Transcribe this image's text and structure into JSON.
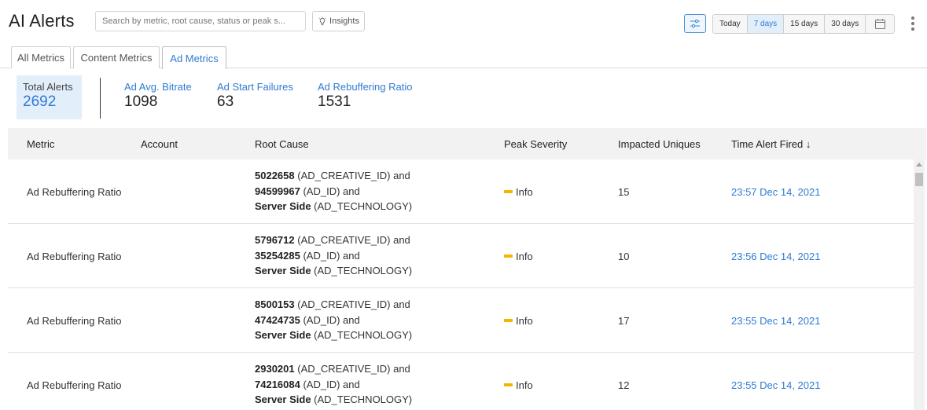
{
  "header": {
    "title": "AI Alerts",
    "search_placeholder": "Search by metric, root cause, status or peak s...",
    "insights_label": "Insights",
    "filter_icon": "sliders-icon",
    "ranges": [
      {
        "label": "Today",
        "active": false
      },
      {
        "label": "7 days",
        "active": true
      },
      {
        "label": "15 days",
        "active": false
      },
      {
        "label": "30 days",
        "active": false
      }
    ],
    "calendar_icon": "calendar-icon",
    "more_icon": "kebab-menu-icon"
  },
  "tabs": [
    {
      "label": "All Metrics",
      "active": false
    },
    {
      "label": "Content Metrics",
      "active": false
    },
    {
      "label": "Ad Metrics",
      "active": true
    }
  ],
  "stats": {
    "total": {
      "label": "Total Alerts",
      "value": "2692"
    },
    "items": [
      {
        "label": "Ad Avg. Bitrate",
        "value": "1098"
      },
      {
        "label": "Ad Start Failures",
        "value": "63"
      },
      {
        "label": "Ad Rebuffering Ratio",
        "value": "1531"
      }
    ]
  },
  "table": {
    "columns": [
      "Metric",
      "Account",
      "Root Cause",
      "Peak Severity",
      "Impacted Uniques",
      "Time Alert Fired ↓"
    ],
    "rows": [
      {
        "metric": "Ad Rebuffering Ratio",
        "account": "",
        "rc": [
          {
            "id": "5022658",
            "type": "(AD_CREATIVE_ID) and"
          },
          {
            "id": "94599967",
            "type": "(AD_ID) and"
          },
          {
            "id": "Server Side",
            "type": "(AD_TECHNOLOGY)"
          }
        ],
        "severity": "Info",
        "uniques": "15",
        "time": "23:57 Dec 14, 2021"
      },
      {
        "metric": "Ad Rebuffering Ratio",
        "account": "",
        "rc": [
          {
            "id": "5796712",
            "type": "(AD_CREATIVE_ID) and"
          },
          {
            "id": "35254285",
            "type": "(AD_ID) and"
          },
          {
            "id": "Server Side",
            "type": "(AD_TECHNOLOGY)"
          }
        ],
        "severity": "Info",
        "uniques": "10",
        "time": "23:56 Dec 14, 2021"
      },
      {
        "metric": "Ad Rebuffering Ratio",
        "account": "",
        "rc": [
          {
            "id": "8500153",
            "type": "(AD_CREATIVE_ID) and"
          },
          {
            "id": "47424735",
            "type": "(AD_ID) and"
          },
          {
            "id": "Server Side",
            "type": "(AD_TECHNOLOGY)"
          }
        ],
        "severity": "Info",
        "uniques": "17",
        "time": "23:55 Dec 14, 2021"
      },
      {
        "metric": "Ad Rebuffering Ratio",
        "account": "",
        "rc": [
          {
            "id": "2930201",
            "type": "(AD_CREATIVE_ID) and"
          },
          {
            "id": "74216084",
            "type": "(AD_ID) and"
          },
          {
            "id": "Server Side",
            "type": "(AD_TECHNOLOGY)"
          }
        ],
        "severity": "Info",
        "uniques": "12",
        "time": "23:55 Dec 14, 2021"
      }
    ]
  },
  "colors": {
    "accent": "#2f7bd3",
    "severity_info": "#f5b400",
    "highlight_bg": "#e3eefb"
  }
}
